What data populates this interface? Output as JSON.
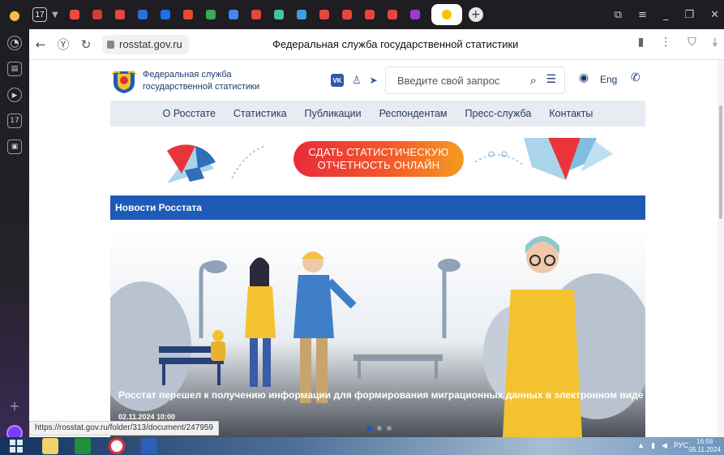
{
  "browser": {
    "tab_count": "17",
    "url": "rosstat.gov.ru",
    "page_title": "Федеральная служба государственной статистики",
    "tab_favicon_colors": [
      "#f04a3a",
      "#d43a3a",
      "#e8453c",
      "#2a6fdb",
      "#1a73e8",
      "#e84a2a",
      "#3aa757",
      "#4285f4",
      "#e8453c",
      "#40c4a0",
      "#3aa0e0",
      "#e8453c",
      "#e8453c",
      "#e8453c",
      "#e8453c",
      "#9a3ad0"
    ]
  },
  "site": {
    "name": "Федеральная служба государственной статистики",
    "name_line1": "Федеральная служба",
    "name_line2": "государственной статистики",
    "vk": "VK",
    "search_placeholder": "Введите свой запрос",
    "lang": "Eng",
    "menu": [
      "О Росстате",
      "Статистика",
      "Публикации",
      "Респондентам",
      "Пресс-служба",
      "Контакты"
    ],
    "cta_line1": "СДАТЬ СТАТИСТИЧЕСКУЮ",
    "cta_line2": "ОТЧЕТНОСТЬ ОНЛАЙН",
    "news_heading": "Новости Росстата",
    "news_caption": "Росстат перешел к получению информации для формирования миграционных данных в электронном виде",
    "news_date": "02.11.2024 10:00"
  },
  "status_url": "https://rosstat.gov.ru/folder/313/document/247959",
  "taskbar": {
    "lang": "РУС",
    "time": "16:58",
    "date": "05.11.2024"
  }
}
